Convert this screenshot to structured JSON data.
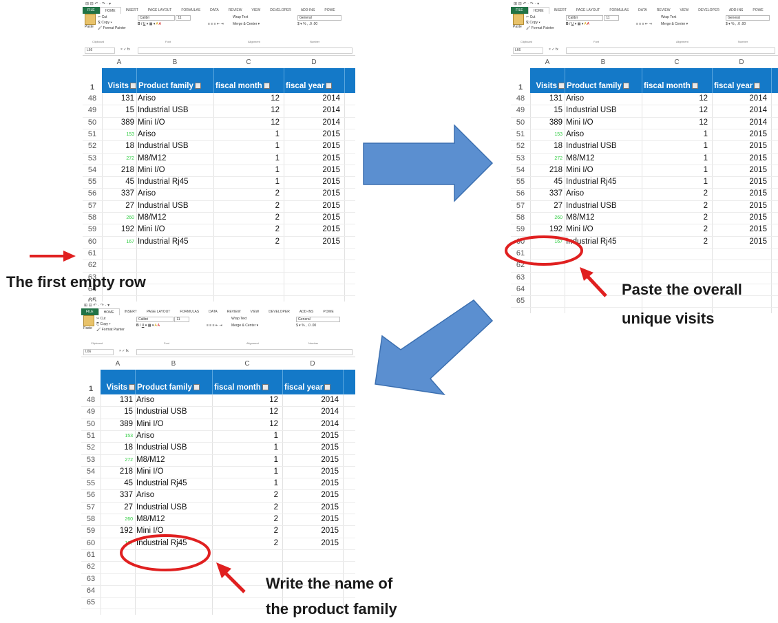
{
  "ribbon": {
    "qat": "⊞ ⊟ ↶ · ↷ · ▾",
    "tabs": [
      "FILE",
      "HOME",
      "INSERT",
      "PAGE LAYOUT",
      "FORMULAS",
      "DATA",
      "REVIEW",
      "VIEW",
      "DEVELOPER",
      "ADD-INS",
      "POWE"
    ],
    "paste_label": "Paste",
    "cut_label": "✂ Cut",
    "copy_label": "⎘ Copy ▾",
    "format_painter_label": "🖌 Format Painter",
    "font_name": "Calibri",
    "font_size": "11",
    "wrap_text_label": "Wrap Text",
    "merge_center_label": "Merge & Center ▾",
    "number_format": "General",
    "group_labels": [
      "Clipboard",
      "Font",
      "Alignment",
      "Number"
    ],
    "name_box": "L66",
    "fx_label": "× ✓ fx"
  },
  "sheet": {
    "columns": [
      "A",
      "B",
      "C",
      "D"
    ],
    "headers": [
      "Visits",
      "Product family",
      "fiscal month",
      "fiscal year"
    ],
    "header_row_number": "1",
    "rows": [
      {
        "n": "48",
        "visits": "131",
        "small": false,
        "family": "Ariso",
        "month": "12",
        "year": "2014"
      },
      {
        "n": "49",
        "visits": "15",
        "small": false,
        "family": "Industrial USB",
        "month": "12",
        "year": "2014"
      },
      {
        "n": "50",
        "visits": "389",
        "small": false,
        "family": "Mini I/O",
        "month": "12",
        "year": "2014"
      },
      {
        "n": "51",
        "visits": "153",
        "small": true,
        "family": "Ariso",
        "month": "1",
        "year": "2015"
      },
      {
        "n": "52",
        "visits": "18",
        "small": false,
        "family": "Industrial USB",
        "month": "1",
        "year": "2015"
      },
      {
        "n": "53",
        "visits": "272",
        "small": true,
        "family": "M8/M12",
        "month": "1",
        "year": "2015"
      },
      {
        "n": "54",
        "visits": "218",
        "small": false,
        "family": "Mini I/O",
        "month": "1",
        "year": "2015"
      },
      {
        "n": "55",
        "visits": "45",
        "small": false,
        "family": "Industrial Rj45",
        "month": "1",
        "year": "2015"
      },
      {
        "n": "56",
        "visits": "337",
        "small": false,
        "family": "Ariso",
        "month": "2",
        "year": "2015"
      },
      {
        "n": "57",
        "visits": "27",
        "small": false,
        "family": "Industrial USB",
        "month": "2",
        "year": "2015"
      },
      {
        "n": "58",
        "visits": "260",
        "small": true,
        "family": "M8/M12",
        "month": "2",
        "year": "2015"
      },
      {
        "n": "59",
        "visits": "192",
        "small": false,
        "family": "Mini I/O",
        "month": "2",
        "year": "2015"
      },
      {
        "n": "60",
        "visits": "167",
        "small": true,
        "family": "Industrial Rj45",
        "month": "2",
        "year": "2015"
      },
      {
        "n": "61",
        "visits": "",
        "small": false,
        "family": "",
        "month": "",
        "year": ""
      },
      {
        "n": "62",
        "visits": "",
        "small": false,
        "family": "",
        "month": "",
        "year": ""
      },
      {
        "n": "63",
        "visits": "",
        "small": false,
        "family": "",
        "month": "",
        "year": ""
      },
      {
        "n": "64",
        "visits": "",
        "small": false,
        "family": "",
        "month": "",
        "year": ""
      },
      {
        "n": "65",
        "visits": "",
        "small": false,
        "family": "",
        "month": "",
        "year": ""
      }
    ]
  },
  "annotations": {
    "first_empty_row": "The first empty row",
    "paste_line1": "Paste the overall",
    "paste_line2": "unique visits",
    "write_line1": "Write the name of",
    "write_line2": "the product family"
  },
  "colors": {
    "header_blue": "#1479c8",
    "arrow_blue": "#5b8fd0",
    "annotation_red": "#e02020",
    "small_visit_green": "#2ecc40"
  }
}
